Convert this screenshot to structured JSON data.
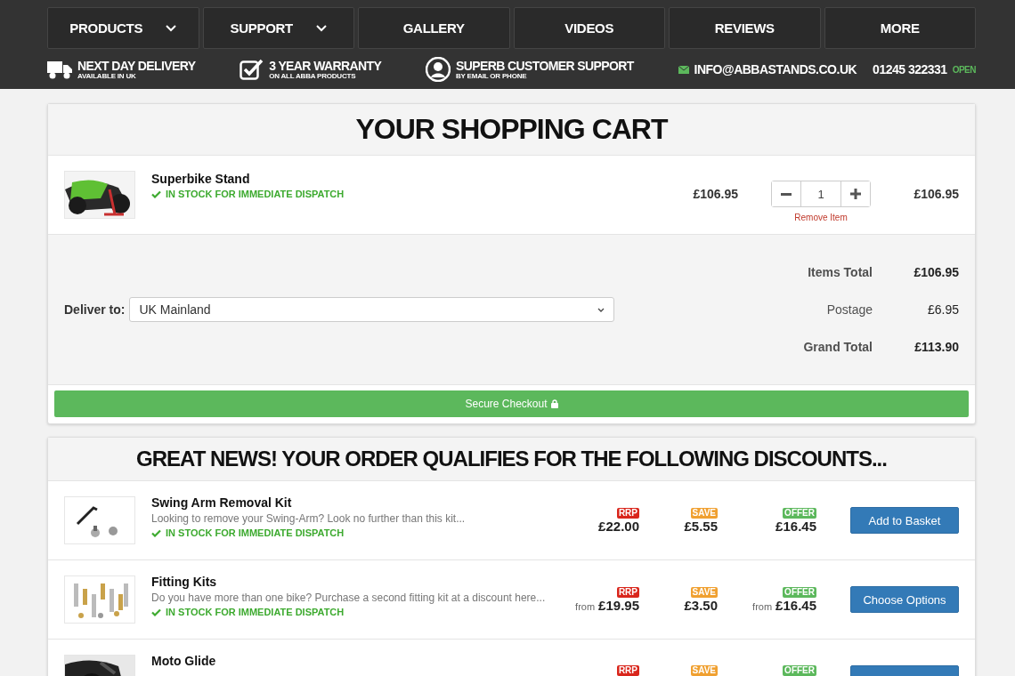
{
  "nav": [
    {
      "label": "PRODUCTS",
      "dropdown": true
    },
    {
      "label": "SUPPORT",
      "dropdown": true
    },
    {
      "label": "GALLERY",
      "dropdown": false
    },
    {
      "label": "VIDEOS",
      "dropdown": false
    },
    {
      "label": "REVIEWS",
      "dropdown": false
    },
    {
      "label": "MORE",
      "dropdown": false
    }
  ],
  "features": [
    {
      "kind": "truck",
      "title": "NEXT DAY DELIVERY",
      "subtitle": "AVAILABLE IN UK"
    },
    {
      "kind": "check",
      "title": "3 YEAR WARRANTY",
      "subtitle": "ON ALL ABBA PRODUCTS"
    },
    {
      "kind": "user",
      "title": "SUPERB CUSTOMER SUPPORT",
      "subtitle": "BY EMAIL OR PHONE"
    }
  ],
  "contact": {
    "email": "INFO@ABBASTANDS.CO.UK",
    "phone": "01245 322331",
    "status": "OPEN"
  },
  "cart": {
    "title": "YOUR SHOPPING CART",
    "items": [
      {
        "name": "Superbike Stand",
        "stock": "IN STOCK FOR IMMEDIATE DISPATCH",
        "price": "£106.95",
        "quantity": "1",
        "remove": "Remove Item",
        "total": "£106.95"
      }
    ],
    "deliver_label": "Deliver to:",
    "deliver_value": "UK Mainland",
    "totals": [
      {
        "label": "Items Total",
        "value": "£106.95",
        "bold": true
      },
      {
        "label": "Postage",
        "value": "£6.95",
        "bold": false
      },
      {
        "label": "Grand Total",
        "value": "£113.90",
        "bold": true
      }
    ],
    "checkout": "Secure Checkout"
  },
  "discounts": {
    "title": "GREAT NEWS! YOUR ORDER QUALIFIES FOR THE FOLLOWING DISCOUNTS...",
    "items": [
      {
        "name": "Swing Arm Removal Kit",
        "description": "Looking to remove your Swing-Arm? Look no further than this kit...",
        "stock": "IN STOCK FOR IMMEDIATE DISPATCH",
        "prices": [
          {
            "kind": "rrp",
            "label": "RRP",
            "value": "£22.00"
          },
          {
            "kind": "save",
            "label": "SAVE",
            "value": "£5.55"
          },
          {
            "kind": "offer",
            "label": "OFFER",
            "value": "£16.45"
          }
        ],
        "button": "Add to Basket"
      },
      {
        "name": "Fitting Kits",
        "description": "Do you have more than one bike? Purchase a second fitting kit at a discount here...",
        "stock": "IN STOCK FOR IMMEDIATE DISPATCH",
        "prices": [
          {
            "kind": "rrp",
            "label": "RRP",
            "from": "from",
            "value": "£19.95"
          },
          {
            "kind": "save",
            "label": "SAVE",
            "value": "£3.50"
          },
          {
            "kind": "offer",
            "label": "OFFER",
            "from": "from",
            "value": "£16.45"
          }
        ],
        "button": "Choose Options"
      },
      {
        "name": "Moto Glide",
        "prices": [
          {
            "kind": "rrp",
            "label": "RRP"
          },
          {
            "kind": "save",
            "label": "SAVE"
          },
          {
            "kind": "offer",
            "label": "OFFER"
          }
        ]
      }
    ]
  }
}
